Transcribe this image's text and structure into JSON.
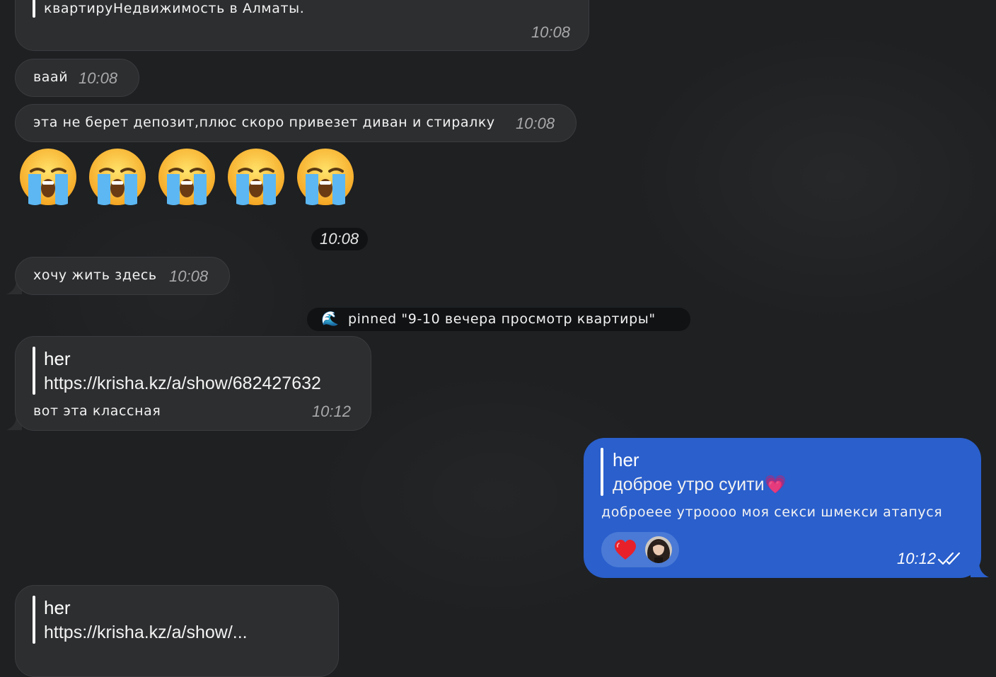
{
  "messages": [
    {
      "id": "m0",
      "text": "квартируНедвижимость в Алматы.",
      "time": "10:08"
    },
    {
      "id": "m1",
      "text": "ваай",
      "time": "10:08"
    },
    {
      "id": "m2",
      "text": "эта не берет депозит,плюс скоро привезет диван и стиралку",
      "time": "10:08"
    },
    {
      "id": "m3",
      "emoji": "loudly-crying-face",
      "count": 5
    },
    {
      "id": "m4",
      "time": "10:08"
    },
    {
      "id": "m5",
      "text": "хочу жить здесь",
      "time": "10:08"
    }
  ],
  "pinned_notice": {
    "icon": "🌊",
    "text": "pinned \"9-10 вечера просмотр квартиры\""
  },
  "reply_in_1": {
    "quote_author": "her",
    "quote_text": "https://krisha.kz/a/show/682427632",
    "text": "вот эта классная",
    "time": "10:12"
  },
  "reply_out": {
    "quote_author": "her",
    "quote_text": "доброе утро суити💗",
    "text": "доброеее утроооо моя секси шмекси атапуся",
    "reaction": "heart",
    "time": "10:12",
    "status": "read"
  },
  "reply_in_2": {
    "quote_author": "her",
    "quote_text": "https://krisha.kz/a/show/..."
  },
  "colors": {
    "background": "#1e2022",
    "incoming": "#2d2e30",
    "outgoing": "#2a5fcc",
    "timestamp": "#a9a9ab",
    "pill": "#111214"
  }
}
